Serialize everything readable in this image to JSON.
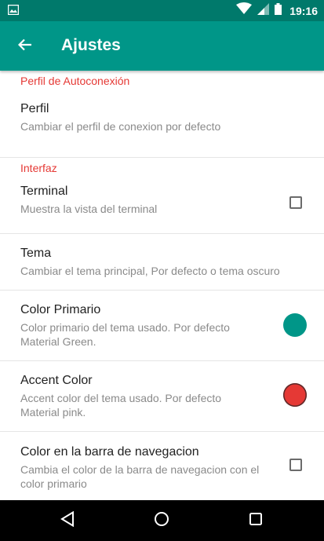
{
  "status_bar": {
    "time": "19:16"
  },
  "app_bar": {
    "title": "Ajustes"
  },
  "sections": {
    "autoconexion": {
      "header": "Perfil de Autoconexión",
      "perfil": {
        "title": "Perfil",
        "summary": "Cambiar el perfil de conexion por defecto"
      }
    },
    "interfaz": {
      "header": "Interfaz",
      "terminal": {
        "title": "Terminal",
        "summary": "Muestra la vista del terminal",
        "checked": false
      },
      "tema": {
        "title": "Tema",
        "summary": "Cambiar el tema principal, Por defecto o tema oscuro"
      },
      "color_primario": {
        "title": "Color Primario",
        "summary": "Color primario del tema usado. Por defecto Material Green.",
        "color": "#009688"
      },
      "accent_color": {
        "title": "Accent Color",
        "summary": "Accent color del tema usado. Por defecto Material pink.",
        "color": "#e53935"
      },
      "nav_color": {
        "title": "Color en la barra de navegacion",
        "summary": "Cambia el color de la barra de navegacion con el color primario",
        "checked": false
      }
    }
  },
  "colors": {
    "status_bar": "#00796b",
    "app_bar": "#009688",
    "section_header": "#e53935"
  },
  "icons": [
    "image-icon",
    "wifi-icon",
    "signal-icon",
    "battery-icon",
    "back-arrow-icon",
    "nav-back-icon",
    "nav-home-icon",
    "nav-recents-icon"
  ]
}
